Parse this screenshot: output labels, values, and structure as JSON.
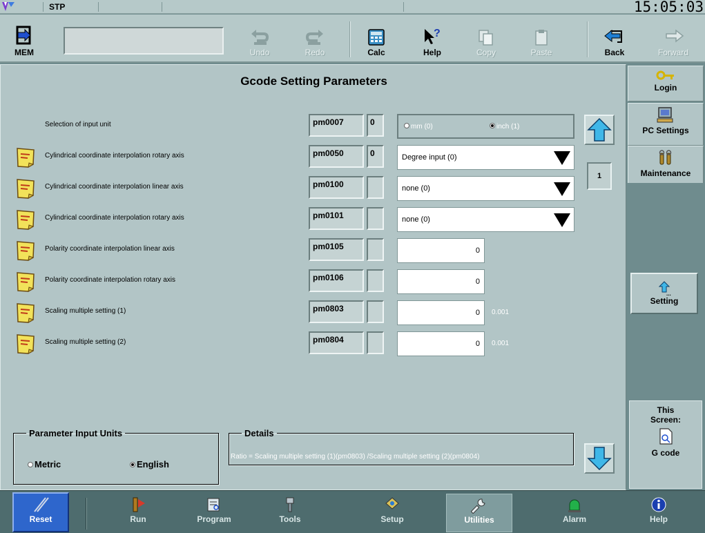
{
  "statusbar": {
    "mode": "STP",
    "clock": "15:05:03"
  },
  "toolbar": {
    "mem_label": "MEM",
    "undo_label": "Undo",
    "redo_label": "Redo",
    "calc_label": "Calc",
    "help_label": "Help",
    "copy_label": "Copy",
    "paste_label": "Paste",
    "back_label": "Back",
    "forward_label": "Forward"
  },
  "page": {
    "title": "Gcode Setting Parameters",
    "page_number": "1",
    "rows": [
      {
        "label": "Selection of input unit",
        "code": "pm0007",
        "value": "0",
        "control": "radio",
        "options": [
          {
            "label": "mm (0)",
            "selected": false
          },
          {
            "label": "inch (1)",
            "selected": true
          }
        ]
      },
      {
        "label": "Cylindrical coordinate interpolation rotary axis",
        "code": "pm0050",
        "value": "0",
        "control": "dropdown",
        "display": "Degree input (0)"
      },
      {
        "label": "Cylindrical coordinate interpolation linear axis",
        "code": "pm0100",
        "value": "",
        "control": "dropdown",
        "display": "none (0)"
      },
      {
        "label": "Cylindrical coordinate interpolation rotary axis",
        "code": "pm0101",
        "value": "",
        "control": "dropdown",
        "display": "none (0)"
      },
      {
        "label": "Polarity coordinate interpolation linear axis",
        "code": "pm0105",
        "value": "",
        "control": "number",
        "display": "0",
        "unit": ""
      },
      {
        "label": "Polarity coordinate interpolation rotary axis",
        "code": "pm0106",
        "value": "",
        "control": "number",
        "display": "0",
        "unit": ""
      },
      {
        "label": "Scaling multiple setting (1)",
        "code": "pm0803",
        "value": "",
        "control": "number",
        "display": "0",
        "unit": "0.001"
      },
      {
        "label": "Scaling multiple setting (2)",
        "code": "pm0804",
        "value": "",
        "control": "number",
        "display": "0",
        "unit": "0.001"
      }
    ]
  },
  "units_group": {
    "legend": "Parameter Input Units",
    "metric": "Metric",
    "english": "English",
    "selected": "english"
  },
  "details": {
    "legend": "Details",
    "text": "Ratio = Scaling multiple setting (1)(pm0803) /Scaling multiple setting (2)(pm0804)"
  },
  "side": {
    "login": "Login",
    "pc_settings": "PC Settings",
    "maintenance": "Maintenance",
    "setting": "Setting",
    "this_screen_1": "This",
    "this_screen_2": "Screen:",
    "this_screen_value": "G code"
  },
  "nav": {
    "reset": "Reset",
    "run": "Run",
    "program": "Program",
    "tools": "Tools",
    "setup": "Setup",
    "utilities": "Utilities",
    "alarm": "Alarm",
    "help": "Help"
  },
  "colors": {
    "panel": "#b2c5c6",
    "frame": "#6f8c8e",
    "nav": "#4e6c6e",
    "reset": "#2e66cc",
    "arrow": "#3fb7e8"
  }
}
